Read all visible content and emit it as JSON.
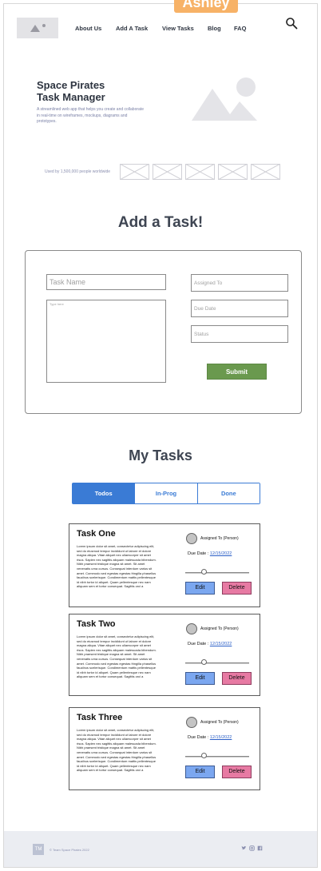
{
  "tag": "Ashley",
  "nav": {
    "items": [
      "About Us",
      "Add A Task",
      "View Tasks",
      "Blog",
      "FAQ"
    ]
  },
  "hero": {
    "title_line1": "Space Pirates",
    "title_line2": "Task Manager",
    "description": "A streamlined web app that helps you create and collaborate in real-time on wireframes, mockups, diagrams and prototypes.",
    "used_by": "Used by 1,500,000 people worldwide"
  },
  "add_task": {
    "heading": "Add a Task!",
    "task_name_placeholder": "Task Name",
    "notes_placeholder": "Type here",
    "assigned_placeholder": "Assigned To",
    "due_placeholder": "Due Date",
    "status_placeholder": "Status",
    "submit_label": "Submit"
  },
  "my_tasks": {
    "heading": "My Tasks",
    "tabs": [
      "Todos",
      "In-Prog",
      "Done"
    ],
    "active_tab": "Todos",
    "cards": [
      {
        "title": "Task One",
        "body": "Lorem ipsum dolor sit amet, consectetur adipiscing elit, sed do eiusmod tempor incididunt ut labore et dolore magna aliqua. Vitae aliquet nec ullamcorper sit amet risus. Sapien nec sagittis aliquam malesuada bibendum. Nibh praesent tristique magna sit amet. Sit amet venenatis urna cursus. Consequat interdum varius sit amet. Commodo sed egestas egestas fringilla phasellus faucibus scelerisque. Condimentum mattis pellentesque id nibh tortor id aliquet. Quam pellentesque nec nam aliquam sem et tortor consequat. Sagittis orci a",
        "assigned": "Assigned To (Person)",
        "due_label": "Due Date :",
        "due_date": "12/15/2022",
        "progress": 0.3,
        "edit_label": "Edit",
        "delete_label": "Delete"
      },
      {
        "title": "Task Two",
        "body": "Lorem ipsum dolor sit amet, consectetur adipiscing elit, sed do eiusmod tempor incididunt ut labore et dolore magna aliqua. Vitae aliquet nec ullamcorper sit amet risus. Sapien nec sagittis aliquam malesuada bibendum. Nibh praesent tristique magna sit amet. Sit amet venenatis urna cursus. Consequat interdum varius sit amet. Commodo sed egestas egestas fringilla phasellus faucibus scelerisque. Condimentum mattis pellentesque id nibh tortor id aliquet. Quam pellentesque nec nam aliquam sem et tortor consequat. Sagittis orci a",
        "assigned": "Assigned To (Person)",
        "due_label": "Due Date :",
        "due_date": "12/15/2022",
        "progress": 0.3,
        "edit_label": "Edit",
        "delete_label": "Delete"
      },
      {
        "title": "Task Three",
        "body": "Lorem ipsum dolor sit amet, consectetur adipiscing elit, sed do eiusmod tempor incididunt ut labore et dolore magna aliqua. Vitae aliquet nec ullamcorper sit amet risus. Sapien nec sagittis aliquam malesuada bibendum. Nibh praesent tristique magna sit amet. Sit amet venenatis urna cursus. Consequat interdum varius sit amet. Commodo sed egestas egestas fringilla phasellus faucibus scelerisque. Condimentum mattis pellentesque id nibh tortor id aliquet. Quam pellentesque nec nam aliquam sem et tortor consequat. Sagittis orci a",
        "assigned": "Assigned To (Person)",
        "due_label": "Due Date :",
        "due_date": "12/15/2022",
        "progress": 0.3,
        "edit_label": "Edit",
        "delete_label": "Delete"
      }
    ]
  },
  "footer": {
    "logo_text": "TM",
    "copyright": "© Team Space Pirates 2022",
    "social_icons": [
      "twitter-icon",
      "instagram-icon",
      "facebook-icon"
    ]
  },
  "colors": {
    "accent_blue": "#3a7bd5",
    "submit_green": "#6a994e",
    "edit_blue": "#7ba7f0",
    "delete_pink": "#e77aa3",
    "tag_orange": "#f7b267"
  }
}
